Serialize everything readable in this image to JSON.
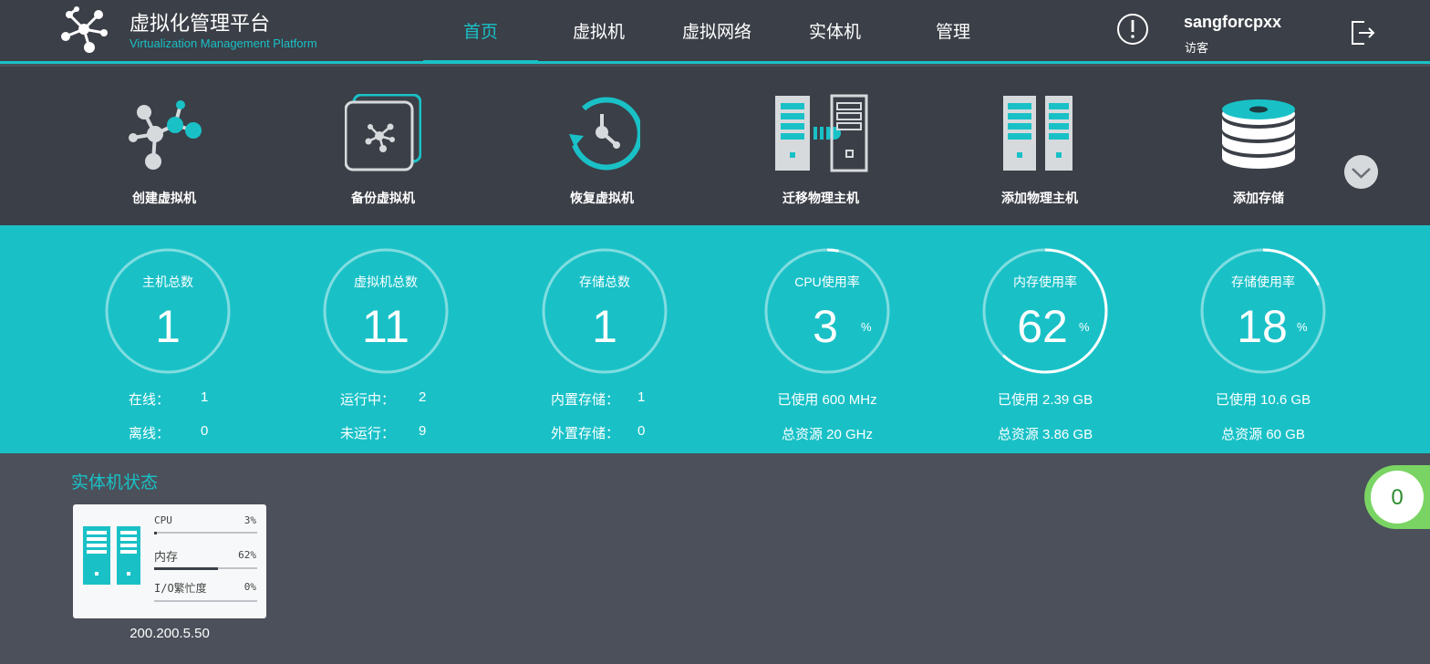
{
  "header": {
    "title": "虚拟化管理平台",
    "subtitle": "Virtualization Management Platform",
    "nav": [
      {
        "label": "首页",
        "active": true
      },
      {
        "label": "虚拟机",
        "active": false
      },
      {
        "label": "虚拟网络",
        "active": false
      },
      {
        "label": "实体机",
        "active": false
      },
      {
        "label": "管理",
        "active": false
      }
    ],
    "user": {
      "name": "sangforcpxx",
      "role": "访客"
    }
  },
  "actions": [
    {
      "label": "创建虚拟机",
      "icon": "create-vm-icon"
    },
    {
      "label": "备份虚拟机",
      "icon": "backup-vm-icon"
    },
    {
      "label": "恢复虚拟机",
      "icon": "restore-vm-icon"
    },
    {
      "label": "迁移物理主机",
      "icon": "migrate-host-icon"
    },
    {
      "label": "添加物理主机",
      "icon": "add-host-icon"
    },
    {
      "label": "添加存储",
      "icon": "add-storage-icon"
    }
  ],
  "stats": {
    "hosts": {
      "title": "主机总数",
      "value": "1",
      "row1_label": "在线：",
      "row1_value": "1",
      "row2_label": "离线：",
      "row2_value": "0"
    },
    "vms": {
      "title": "虚拟机总数",
      "value": "11",
      "row1_label": "运行中：",
      "row1_value": "2",
      "row2_label": "未运行：",
      "row2_value": "9"
    },
    "storage": {
      "title": "存储总数",
      "value": "1",
      "row1_label": "内置存储：",
      "row1_value": "1",
      "row2_label": "外置存储：",
      "row2_value": "0"
    },
    "cpu": {
      "title": "CPU使用率",
      "value": "3",
      "unit": "%",
      "used": "已使用 600 MHz",
      "total": "总资源 20 GHz",
      "percent": 3
    },
    "memory": {
      "title": "内存使用率",
      "value": "62",
      "unit": "%",
      "used": "已使用 2.39 GB",
      "total": "总资源 3.86 GB",
      "percent": 62
    },
    "disk": {
      "title": "存储使用率",
      "value": "18",
      "unit": "%",
      "used": "已使用 10.6 GB",
      "total": "总资源 60 GB",
      "percent": 18
    }
  },
  "host_status": {
    "title": "实体机状态",
    "hosts": [
      {
        "ip": "200.200.5.50",
        "metrics": [
          {
            "name": "CPU",
            "value": "3%",
            "percent": 3
          },
          {
            "name": "内存",
            "value": "62%",
            "percent": 62
          },
          {
            "name": "I/O繁忙度",
            "value": "0%",
            "percent": 0
          }
        ]
      }
    ]
  },
  "alarm_count": "0",
  "colors": {
    "accent": "#19c1c7",
    "header_bg": "#3b3f47",
    "body_bg": "#4b505a",
    "badge": "#7ad463"
  }
}
